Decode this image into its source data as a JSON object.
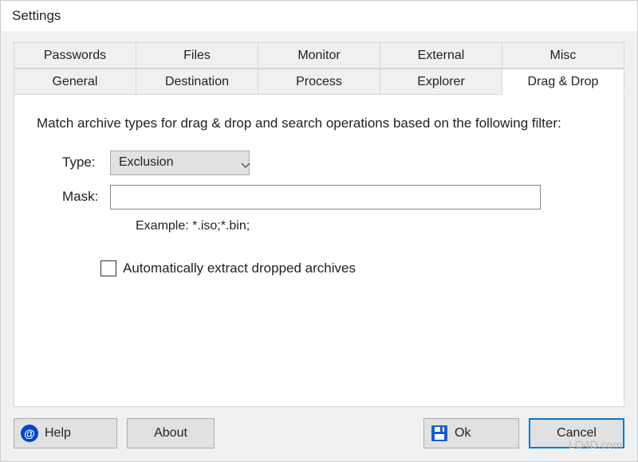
{
  "window": {
    "title": "Settings"
  },
  "tabs": {
    "row1": [
      {
        "label": "Passwords"
      },
      {
        "label": "Files"
      },
      {
        "label": "Monitor"
      },
      {
        "label": "External"
      },
      {
        "label": "Misc"
      }
    ],
    "row2": [
      {
        "label": "General"
      },
      {
        "label": "Destination"
      },
      {
        "label": "Process"
      },
      {
        "label": "Explorer"
      },
      {
        "label": "Drag & Drop",
        "active": true
      }
    ]
  },
  "panel": {
    "description": "Match archive types for drag & drop and search operations based on the following filter:",
    "type_label": "Type:",
    "type_value": "Exclusion",
    "mask_label": "Mask:",
    "mask_value": "",
    "example": "Example: *.iso;*.bin;",
    "auto_extract_label": "Automatically extract dropped archives",
    "auto_extract_checked": false
  },
  "buttons": {
    "help": "Help",
    "about": "About",
    "ok": "Ok",
    "cancel": "Cancel"
  },
  "watermark": "LO4D.com"
}
